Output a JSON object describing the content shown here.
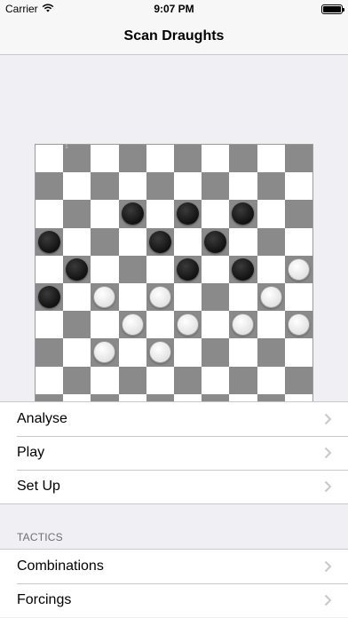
{
  "status_bar": {
    "carrier": "Carrier",
    "time": "9:07 PM",
    "battery_level": 1.0,
    "icons": [
      "wifi-icon",
      "battery-icon"
    ]
  },
  "nav": {
    "title": "Scan Draughts"
  },
  "board": {
    "size": 10,
    "corner_number": "1",
    "light_color": "#ffffff",
    "dark_color": "#8a8a8a",
    "pieces": [
      {
        "color": "black",
        "row": 2,
        "col": 3
      },
      {
        "color": "black",
        "row": 2,
        "col": 5
      },
      {
        "color": "black",
        "row": 2,
        "col": 7
      },
      {
        "color": "black",
        "row": 3,
        "col": 0
      },
      {
        "color": "black",
        "row": 3,
        "col": 4
      },
      {
        "color": "black",
        "row": 3,
        "col": 6
      },
      {
        "color": "black",
        "row": 4,
        "col": 1
      },
      {
        "color": "black",
        "row": 4,
        "col": 5
      },
      {
        "color": "black",
        "row": 4,
        "col": 7
      },
      {
        "color": "white",
        "row": 4,
        "col": 9
      },
      {
        "color": "black",
        "row": 5,
        "col": 0
      },
      {
        "color": "white",
        "row": 5,
        "col": 2
      },
      {
        "color": "white",
        "row": 5,
        "col": 4
      },
      {
        "color": "white",
        "row": 5,
        "col": 8
      },
      {
        "color": "white",
        "row": 6,
        "col": 3
      },
      {
        "color": "white",
        "row": 6,
        "col": 5
      },
      {
        "color": "white",
        "row": 6,
        "col": 7
      },
      {
        "color": "white",
        "row": 6,
        "col": 9
      },
      {
        "color": "white",
        "row": 7,
        "col": 2
      },
      {
        "color": "white",
        "row": 7,
        "col": 4
      }
    ]
  },
  "menu": {
    "items": [
      {
        "label": "Analyse"
      },
      {
        "label": "Play"
      },
      {
        "label": "Set Up"
      }
    ]
  },
  "tactics": {
    "header": "TACTICS",
    "items": [
      {
        "label": "Combinations"
      },
      {
        "label": "Forcings"
      }
    ]
  }
}
